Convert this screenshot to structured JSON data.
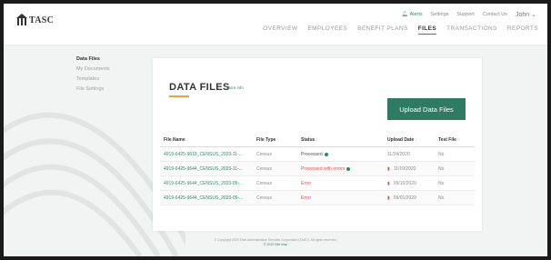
{
  "brand": {
    "name": "TASC"
  },
  "util_nav": {
    "alerts": "Alerts",
    "settings": "Settings",
    "support": "Support",
    "contact": "Contact Us",
    "user": "John"
  },
  "main_nav": [
    "OVERVIEW",
    "EMPLOYEES",
    "BENEFIT PLANS",
    "FILES",
    "TRANSACTIONS",
    "REPORTS"
  ],
  "main_nav_active": "FILES",
  "sidebar": {
    "items": [
      "Data Files",
      "My Documents",
      "Templates",
      "File Settings"
    ],
    "active": "Data Files"
  },
  "card": {
    "title": "DATA FILES",
    "more_info": "More info",
    "upload_button": "Upload Data Files"
  },
  "table": {
    "headers": [
      "File Name",
      "File Type",
      "Status",
      "Upload Date",
      "Test File"
    ],
    "rows": [
      {
        "file_name": "4919-6425-9618_CENSUS_2020-11-...",
        "file_type": "Census",
        "status": "Processed",
        "status_kind": "ok",
        "warning": false,
        "upload_date": "11/24/2020",
        "test_file": "No"
      },
      {
        "file_name": "4919-6425-9644_CENSUS_2020-11-...",
        "file_type": "Census",
        "status": "Processed with errors",
        "status_kind": "error-ok",
        "warning": true,
        "upload_date": "11/10/2020",
        "test_file": "No"
      },
      {
        "file_name": "4919-6425-9644_CENSUS_2020-09-...",
        "file_type": "Census",
        "status": "Error",
        "status_kind": "error",
        "warning": true,
        "upload_date": "09/10/2020",
        "test_file": "No"
      },
      {
        "file_name": "4919-6425-9644_CENSUS_2020-09-...",
        "file_type": "Census",
        "status": "Error",
        "status_kind": "error",
        "warning": true,
        "upload_date": "09/01/2020",
        "test_file": "No"
      }
    ]
  },
  "footer": {
    "line1": "© Copyright 2020 Total Administrative Services Corporation (TASC). All rights reserved.",
    "line2": "© 2020 Site map"
  },
  "colors": {
    "accent": "#2e8b6e",
    "button": "#2f7a63",
    "error": "#d9534f",
    "underline": "#e8a33a"
  }
}
